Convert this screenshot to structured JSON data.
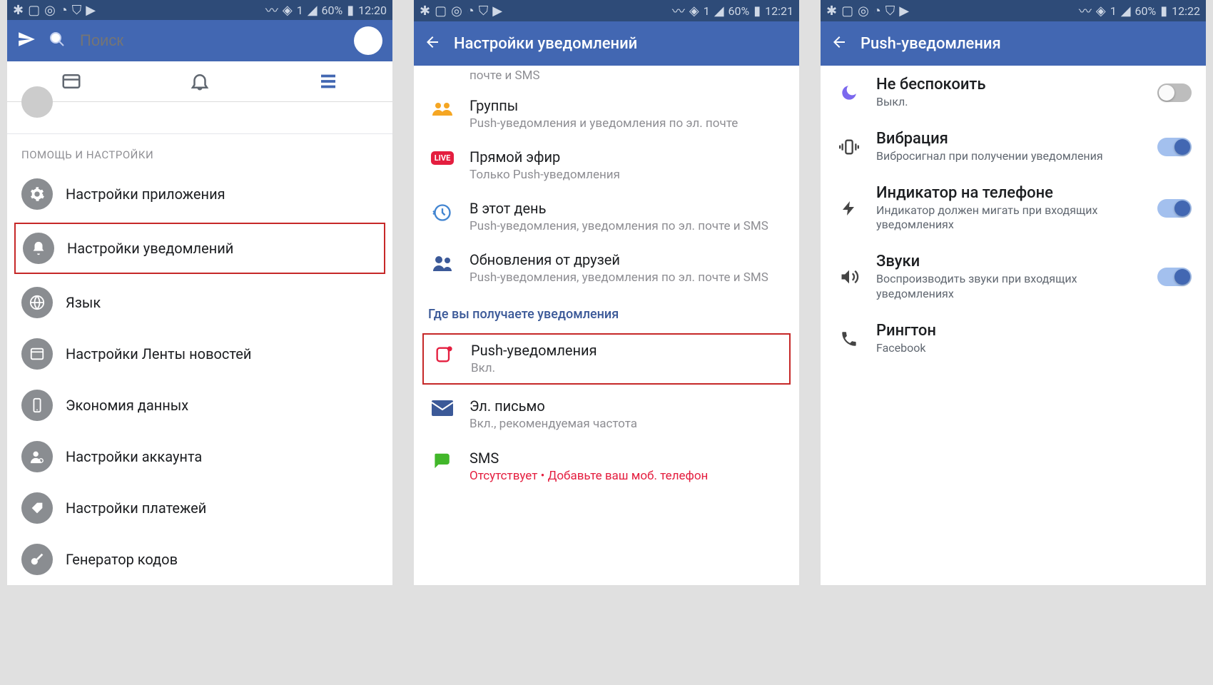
{
  "status": {
    "battery": "60%",
    "sim": "1"
  },
  "screen1": {
    "time": "12:20",
    "search_placeholder": "Поиск",
    "section": "ПОМОЩЬ И НАСТРОЙКИ",
    "items": [
      {
        "label": "Настройки приложения"
      },
      {
        "label": "Настройки уведомлений"
      },
      {
        "label": "Язык"
      },
      {
        "label": "Настройки Ленты новостей"
      },
      {
        "label": "Экономия данных"
      },
      {
        "label": "Настройки аккаунта"
      },
      {
        "label": "Настройки платежей"
      },
      {
        "label": "Генератор кодов"
      }
    ]
  },
  "screen2": {
    "time": "12:21",
    "title": "Настройки уведомлений",
    "truncated_sub": "почте и SMS",
    "rows": [
      {
        "title": "Группы",
        "sub": "Push-уведомления и уведомления по эл. почте"
      },
      {
        "title": "Прямой эфир",
        "sub": "Только Push-уведомления"
      },
      {
        "title": "В этот день",
        "sub": "Push-уведомления, уведомления по эл. почте и SMS"
      },
      {
        "title": "Обновления от друзей",
        "sub": "Push-уведомления, уведомления по эл. почте и SMS"
      }
    ],
    "where_header": "Где вы получаете уведомления",
    "dests": [
      {
        "title": "Push-уведомления",
        "sub": "Вкл."
      },
      {
        "title": "Эл. письмо",
        "sub": "Вкл., рекомендуемая частота"
      },
      {
        "title": "SMS",
        "sub": "Отсутствует • Добавьте ваш моб. телефон"
      }
    ]
  },
  "screen3": {
    "time": "12:22",
    "title": "Push-уведомления",
    "rows": [
      {
        "title": "Не беспокоить",
        "sub": "Выкл.",
        "toggle": "off"
      },
      {
        "title": "Вибрация",
        "sub": "Вибросигнал при получении уведомления",
        "toggle": "on"
      },
      {
        "title": "Индикатор на телефоне",
        "sub": "Индикатор должен мигать при входящих уведомлениях",
        "toggle": "on"
      },
      {
        "title": "Звуки",
        "sub": "Воспроизводить звуки при входящих уведомлениях",
        "toggle": "on"
      },
      {
        "title": "Рингтон",
        "sub": "Facebook",
        "toggle": null
      }
    ]
  }
}
